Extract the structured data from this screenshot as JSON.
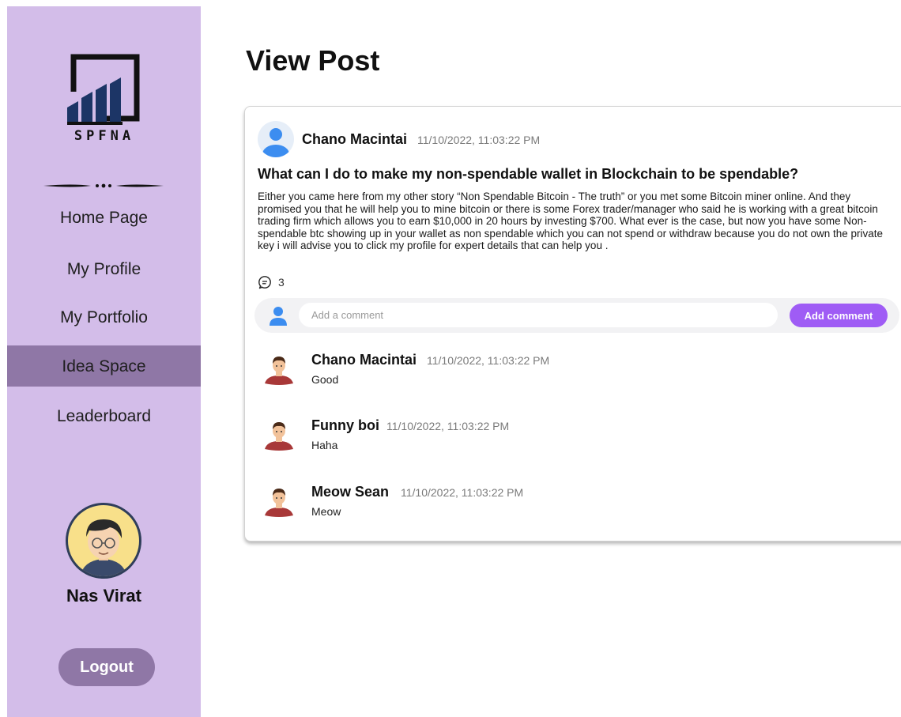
{
  "sidebar": {
    "logo_text": "SPFNA",
    "nav": [
      {
        "label": "Home Page"
      },
      {
        "label": "My Profile"
      },
      {
        "label": "My Portfolio"
      },
      {
        "label": "Idea Space",
        "active": true
      },
      {
        "label": "Leaderboard"
      }
    ],
    "user_name": "Nas Virat",
    "logout_label": "Logout"
  },
  "page_title": "View Post",
  "post": {
    "author": "Chano Macintai",
    "timestamp": "11/10/2022, 11:03:22 PM",
    "title": "What can I do to make my non-spendable wallet in Blockchain to be spendable?",
    "body": "Either you came here from my other story “Non Spendable Bitcoin - The truth” or you met some Bitcoin miner online. And they promised you that he will help you to mine bitcoin or there is some Forex trader/manager who said he is working with a great bitcoin trading firm which allows you to earn $10,000 in 20 hours by investing $700. What ever is the case, but now you have some Non-spendable btc showing up in your wallet as non spendable which you can not spend or withdraw because you do not own the private key i will advise you to click my profile for expert details that can help you .",
    "comment_count": "3"
  },
  "comment_box": {
    "placeholder": "Add a comment",
    "button_label": "Add comment"
  },
  "comments": [
    {
      "author": "Chano Macintai",
      "timestamp": "11/10/2022, 11:03:22 PM",
      "text": "Good"
    },
    {
      "author": "Funny boi",
      "timestamp": "11/10/2022, 11:03:22 PM",
      "text": "Haha"
    },
    {
      "author": "Meow Sean",
      "timestamp": "11/10/2022, 11:03:22 PM",
      "text": "Meow"
    }
  ],
  "colors": {
    "sidebar_bg": "#d3bde9",
    "nav_active_bg": "#8f77a6",
    "accent_button": "#9f5cf5",
    "avatar_blue": "#3c8df0"
  }
}
